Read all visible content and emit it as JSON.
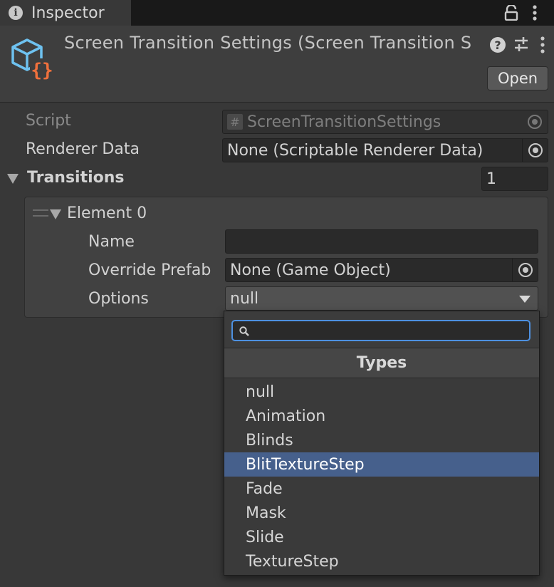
{
  "tab": {
    "title": "Inspector"
  },
  "header": {
    "title": "Screen Transition Settings (Screen Transition S",
    "open_label": "Open",
    "help_glyph": "?"
  },
  "fields": {
    "script": {
      "label": "Script",
      "value": "ScreenTransitionSettings"
    },
    "renderer_data": {
      "label": "Renderer Data",
      "value": "None (Scriptable Renderer Data)"
    },
    "transitions": {
      "label": "Transitions",
      "count": "1"
    }
  },
  "element": {
    "title": "Element 0",
    "name_label": "Name",
    "name_value": "",
    "override_label": "Override Prefab",
    "override_value": "None (Game Object)",
    "options_label": "Options",
    "options_value": "null"
  },
  "popup": {
    "search_value": "",
    "header": "Types",
    "items": [
      "null",
      "Animation",
      "Blinds",
      "BlitTextureStep",
      "Fade",
      "Mask",
      "Slide",
      "TextureStep"
    ],
    "selected": "BlitTextureStep"
  },
  "colors": {
    "accent": "#4d90e0",
    "selection": "#46608c",
    "icon_cube": "#6ec2f0",
    "icon_braces": "#f0703c"
  }
}
